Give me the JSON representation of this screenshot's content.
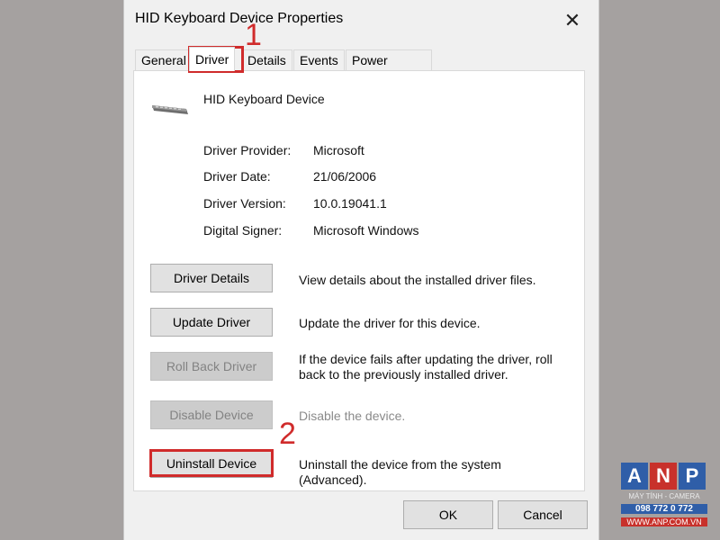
{
  "dialog": {
    "title": "HID Keyboard Device Properties",
    "close_glyph": "✕"
  },
  "tabs": [
    {
      "label": "General"
    },
    {
      "label": "Driver"
    },
    {
      "label": "Details"
    },
    {
      "label": "Events"
    },
    {
      "label": "Power Management"
    }
  ],
  "device": {
    "name": "HID Keyboard Device",
    "icon": "keyboard-icon"
  },
  "info": [
    {
      "label": "Driver Provider:",
      "value": "Microsoft"
    },
    {
      "label": "Driver Date:",
      "value": "21/06/2006"
    },
    {
      "label": "Driver Version:",
      "value": "10.0.19041.1"
    },
    {
      "label": "Digital Signer:",
      "value": "Microsoft Windows"
    }
  ],
  "actions": [
    {
      "label": "Driver Details",
      "desc": "View details about the installed driver files."
    },
    {
      "label": "Update Driver",
      "desc": "Update the driver for this device."
    },
    {
      "label": "Roll Back Driver",
      "desc": "If the device fails after updating the driver, roll back to the previously installed driver."
    },
    {
      "label": "Disable Device",
      "desc": "Disable the device."
    },
    {
      "label": "Uninstall Device",
      "desc": "Uninstall the device from the system (Advanced)."
    }
  ],
  "footer": {
    "ok_label": "OK",
    "cancel_label": "Cancel"
  },
  "annotations": {
    "step1": "1",
    "step2": "2",
    "color": "#d02b2b"
  },
  "logo": {
    "letters": [
      "A",
      "N",
      "P"
    ],
    "tagline": "MÁY TÍNH - CAMERA",
    "phone": "098 772 0 772",
    "site": "WWW.ANP.COM.VN",
    "colors": [
      "#2f5ea8",
      "#c8312b",
      "#2f5ea8"
    ]
  }
}
